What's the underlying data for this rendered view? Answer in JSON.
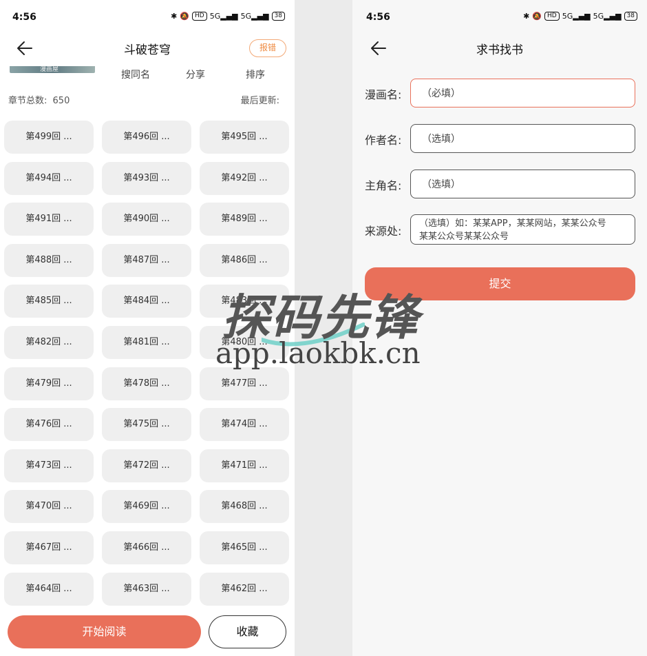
{
  "status": {
    "time": "4:56",
    "battery": "38",
    "hd": "HD",
    "net1": "5G",
    "net2": "5G"
  },
  "left": {
    "title": "斗破苍穹",
    "report_label": "报错",
    "cover_text": "漫画屋",
    "tabs": [
      "搜同名",
      "分享",
      "排序"
    ],
    "chapter_total_label": "章节总数:",
    "chapter_total": "650",
    "last_update_label": "最后更新:",
    "chapters": [
      "第499回 ...",
      "第496回 ...",
      "第495回 ...",
      "第494回 ...",
      "第493回 ...",
      "第492回 ...",
      "第491回 ...",
      "第490回 ...",
      "第489回 ...",
      "第488回 ...",
      "第487回 ...",
      "第486回 ...",
      "第485回 ...",
      "第484回 ...",
      "第483回 ...",
      "第482回 ...",
      "第481回 ...",
      "第480回 ...",
      "第479回 ...",
      "第478回 ...",
      "第477回 ...",
      "第476回 ...",
      "第475回 ...",
      "第474回 ...",
      "第473回 ...",
      "第472回 ...",
      "第471回 ...",
      "第470回 ...",
      "第469回 ...",
      "第468回 ...",
      "第467回 ...",
      "第466回 ...",
      "第465回 ...",
      "第464回 ...",
      "第463回 ...",
      "第462回 ..."
    ],
    "start_read_label": "开始阅读",
    "favorite_label": "收藏"
  },
  "right": {
    "title": "求书找书",
    "fields": [
      {
        "label": "漫画名:",
        "placeholder": "（必填）"
      },
      {
        "label": "作者名:",
        "placeholder": "（选填）"
      },
      {
        "label": "主角名:",
        "placeholder": "（选填）"
      },
      {
        "label": "来源处:",
        "placeholder_line1": "（选填）如：某某APP，某某网站，某某公众号",
        "placeholder_line2": "某某公众号某某公众号"
      }
    ],
    "submit_label": "提交"
  },
  "watermark": {
    "main": "探码先锋",
    "sub": "app.laokbk.cn"
  },
  "colors": {
    "accent": "#e9705a",
    "report": "#ef8a40",
    "chapter_bg": "#efefef"
  }
}
